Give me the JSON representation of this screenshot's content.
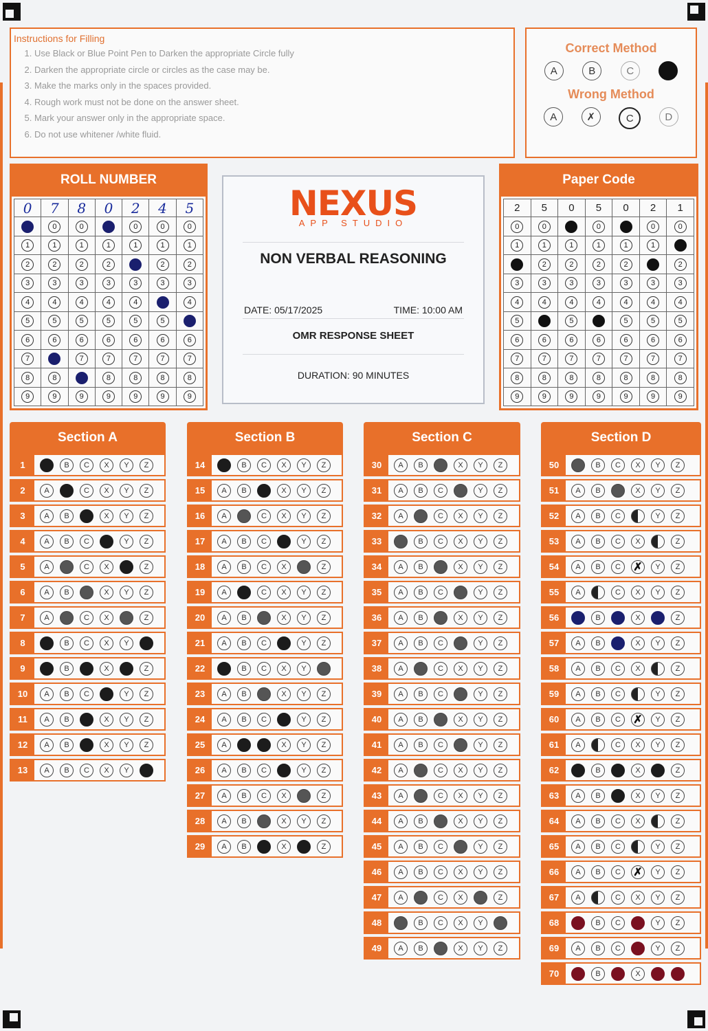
{
  "instructions": {
    "title": "Instructions for Filling",
    "items": [
      "Use Black or Blue Point Pen to Darken the appropriate Circle fully",
      "Darken the appropriate circle or circles as the case may be.",
      "Make the marks only in the spaces provided.",
      "Rough work must not be done on the answer sheet.",
      "Mark your answer only in the appropriate space.",
      "Do not use whitener /white fluid."
    ]
  },
  "methods": {
    "correct_title": "Correct Method",
    "correct": [
      {
        "t": "A",
        "s": ""
      },
      {
        "t": "B",
        "s": ""
      },
      {
        "t": "C",
        "s": "faint"
      },
      {
        "t": "",
        "s": "fill"
      }
    ],
    "wrong_title": "Wrong Method",
    "wrong": [
      {
        "t": "A",
        "s": ""
      },
      {
        "t": "✗",
        "s": ""
      },
      {
        "t": "C",
        "s": "thick"
      },
      {
        "t": "D",
        "s": "faint"
      }
    ]
  },
  "roll": {
    "title": "ROLL NUMBER",
    "digits": [
      "0",
      "7",
      "8",
      "0",
      "2",
      "4",
      "5"
    ]
  },
  "paper": {
    "title": "Paper Code",
    "digits": [
      "2",
      "5",
      "0",
      "5",
      "0",
      "2",
      "1"
    ]
  },
  "center": {
    "logo": "NEXUS",
    "logo_sub": "APP STUDIO",
    "subject": "NON VERBAL REASONING",
    "date": "DATE: 05/17/2025",
    "time": "TIME: 10:00 AM",
    "sheet": "OMR RESPONSE SHEET",
    "duration": "DURATION: 90 MINUTES"
  },
  "option_letters": [
    "A",
    "B",
    "C",
    "X",
    "Y",
    "Z"
  ],
  "sections": [
    {
      "title": "Section A",
      "answers": [
        {
          "q": "1",
          "m": [
            "k",
            "",
            "",
            "",
            "",
            ""
          ]
        },
        {
          "q": "2",
          "m": [
            "",
            "k",
            "",
            "",
            "",
            ""
          ]
        },
        {
          "q": "3",
          "m": [
            "",
            "",
            "k",
            "",
            "",
            ""
          ]
        },
        {
          "q": "4",
          "m": [
            "",
            "",
            "",
            "k",
            "",
            ""
          ]
        },
        {
          "q": "5",
          "m": [
            "",
            "g",
            "",
            "",
            "k",
            ""
          ]
        },
        {
          "q": "6",
          "m": [
            "",
            "",
            "g",
            "",
            "",
            ""
          ]
        },
        {
          "q": "7",
          "m": [
            "",
            "g",
            "",
            "",
            "g",
            ""
          ]
        },
        {
          "q": "8",
          "m": [
            "k",
            "",
            "",
            "",
            "",
            "k"
          ]
        },
        {
          "q": "9",
          "m": [
            "k",
            "",
            "k",
            "",
            "k",
            ""
          ]
        },
        {
          "q": "10",
          "m": [
            "",
            "",
            "",
            "k",
            "",
            ""
          ]
        },
        {
          "q": "11",
          "m": [
            "",
            "",
            "k",
            "",
            "",
            ""
          ]
        },
        {
          "q": "12",
          "m": [
            "",
            "",
            "k",
            "",
            "",
            ""
          ]
        },
        {
          "q": "13",
          "m": [
            "",
            "",
            "",
            "",
            "",
            "k"
          ]
        }
      ]
    },
    {
      "title": "Section B",
      "answers": [
        {
          "q": "14",
          "m": [
            "k",
            "",
            "",
            "",
            "",
            ""
          ]
        },
        {
          "q": "15",
          "m": [
            "",
            "",
            "k",
            "",
            "",
            ""
          ]
        },
        {
          "q": "16",
          "m": [
            "",
            "g",
            "",
            "",
            "",
            ""
          ]
        },
        {
          "q": "17",
          "m": [
            "",
            "",
            "",
            "k",
            "",
            ""
          ]
        },
        {
          "q": "18",
          "m": [
            "",
            "",
            "",
            "",
            "g",
            ""
          ]
        },
        {
          "q": "19",
          "m": [
            "",
            "k",
            "",
            "",
            "",
            ""
          ]
        },
        {
          "q": "20",
          "m": [
            "",
            "",
            "g",
            "",
            "",
            ""
          ]
        },
        {
          "q": "21",
          "m": [
            "",
            "",
            "",
            "k",
            "",
            ""
          ]
        },
        {
          "q": "22",
          "m": [
            "k",
            "",
            "",
            "",
            "",
            "g"
          ]
        },
        {
          "q": "23",
          "m": [
            "",
            "",
            "g",
            "",
            "",
            ""
          ]
        },
        {
          "q": "24",
          "m": [
            "",
            "",
            "",
            "k",
            "",
            ""
          ]
        },
        {
          "q": "25",
          "m": [
            "",
            "k",
            "k",
            "",
            "",
            ""
          ]
        },
        {
          "q": "26",
          "m": [
            "",
            "",
            "",
            "k",
            "",
            ""
          ]
        },
        {
          "q": "27",
          "m": [
            "",
            "",
            "",
            "",
            "g",
            ""
          ]
        },
        {
          "q": "28",
          "m": [
            "",
            "",
            "g",
            "",
            "",
            ""
          ]
        },
        {
          "q": "29",
          "m": [
            "",
            "",
            "k",
            "",
            "k",
            ""
          ]
        }
      ]
    },
    {
      "title": "Section C",
      "answers": [
        {
          "q": "30",
          "m": [
            "",
            "",
            "g",
            "",
            "",
            ""
          ]
        },
        {
          "q": "31",
          "m": [
            "",
            "",
            "",
            "g",
            "",
            ""
          ]
        },
        {
          "q": "32",
          "m": [
            "",
            "g",
            "",
            "",
            "",
            ""
          ]
        },
        {
          "q": "33",
          "m": [
            "g",
            "",
            "",
            "",
            "",
            ""
          ]
        },
        {
          "q": "34",
          "m": [
            "",
            "",
            "g",
            "",
            "",
            ""
          ]
        },
        {
          "q": "35",
          "m": [
            "",
            "",
            "",
            "g",
            "",
            ""
          ]
        },
        {
          "q": "36",
          "m": [
            "",
            "",
            "g",
            "",
            "",
            ""
          ]
        },
        {
          "q": "37",
          "m": [
            "",
            "",
            "",
            "g",
            "",
            ""
          ]
        },
        {
          "q": "38",
          "m": [
            "",
            "g",
            "",
            "",
            "",
            ""
          ]
        },
        {
          "q": "39",
          "m": [
            "",
            "",
            "",
            "g",
            "",
            ""
          ]
        },
        {
          "q": "40",
          "m": [
            "",
            "",
            "g",
            "",
            "",
            ""
          ]
        },
        {
          "q": "41",
          "m": [
            "",
            "",
            "",
            "g",
            "",
            ""
          ]
        },
        {
          "q": "42",
          "m": [
            "",
            "g",
            "",
            "",
            "",
            ""
          ]
        },
        {
          "q": "43",
          "m": [
            "",
            "g",
            "",
            "",
            "",
            ""
          ]
        },
        {
          "q": "44",
          "m": [
            "",
            "",
            "g",
            "",
            "",
            ""
          ]
        },
        {
          "q": "45",
          "m": [
            "",
            "",
            "",
            "g",
            "",
            ""
          ]
        },
        {
          "q": "46",
          "m": [
            "",
            "",
            "",
            "",
            "",
            ""
          ]
        },
        {
          "q": "47",
          "m": [
            "",
            "g",
            "",
            "",
            "g",
            ""
          ]
        },
        {
          "q": "48",
          "m": [
            "g",
            "",
            "",
            "",
            "",
            "g"
          ]
        },
        {
          "q": "49",
          "m": [
            "",
            "",
            "g",
            "",
            "",
            ""
          ]
        }
      ]
    },
    {
      "title": "Section D",
      "answers": [
        {
          "q": "50",
          "m": [
            "g",
            "",
            "",
            "",
            "",
            ""
          ]
        },
        {
          "q": "51",
          "m": [
            "",
            "",
            "g",
            "",
            "",
            ""
          ]
        },
        {
          "q": "52",
          "m": [
            "",
            "",
            "",
            "h",
            "",
            ""
          ]
        },
        {
          "q": "53",
          "m": [
            "",
            "",
            "",
            "",
            "h",
            ""
          ]
        },
        {
          "q": "54",
          "m": [
            "",
            "",
            "",
            "x",
            "",
            ""
          ]
        },
        {
          "q": "55",
          "m": [
            "",
            "h",
            "",
            "",
            "",
            ""
          ]
        },
        {
          "q": "56",
          "m": [
            "b",
            "",
            "b",
            "",
            "b",
            ""
          ]
        },
        {
          "q": "57",
          "m": [
            "",
            "",
            "b",
            "",
            "",
            ""
          ]
        },
        {
          "q": "58",
          "m": [
            "",
            "",
            "",
            "",
            "h",
            ""
          ]
        },
        {
          "q": "59",
          "m": [
            "",
            "",
            "",
            "h",
            "",
            ""
          ]
        },
        {
          "q": "60",
          "m": [
            "",
            "",
            "",
            "x",
            "",
            ""
          ]
        },
        {
          "q": "61",
          "m": [
            "",
            "h",
            "",
            "",
            "",
            ""
          ]
        },
        {
          "q": "62",
          "m": [
            "k",
            "",
            "k",
            "",
            "k",
            ""
          ]
        },
        {
          "q": "63",
          "m": [
            "",
            "",
            "k",
            "",
            "",
            ""
          ]
        },
        {
          "q": "64",
          "m": [
            "",
            "",
            "",
            "",
            "h",
            ""
          ]
        },
        {
          "q": "65",
          "m": [
            "",
            "",
            "",
            "h",
            "",
            ""
          ]
        },
        {
          "q": "66",
          "m": [
            "",
            "",
            "",
            "x",
            "",
            ""
          ]
        },
        {
          "q": "67",
          "m": [
            "",
            "h",
            "",
            "",
            "",
            ""
          ]
        },
        {
          "q": "68",
          "m": [
            "r",
            "",
            "",
            "r",
            "",
            ""
          ]
        },
        {
          "q": "69",
          "m": [
            "",
            "",
            "",
            "r",
            "",
            ""
          ]
        },
        {
          "q": "70",
          "m": [
            "r",
            "",
            "r",
            "",
            "r",
            "r"
          ]
        }
      ]
    }
  ]
}
